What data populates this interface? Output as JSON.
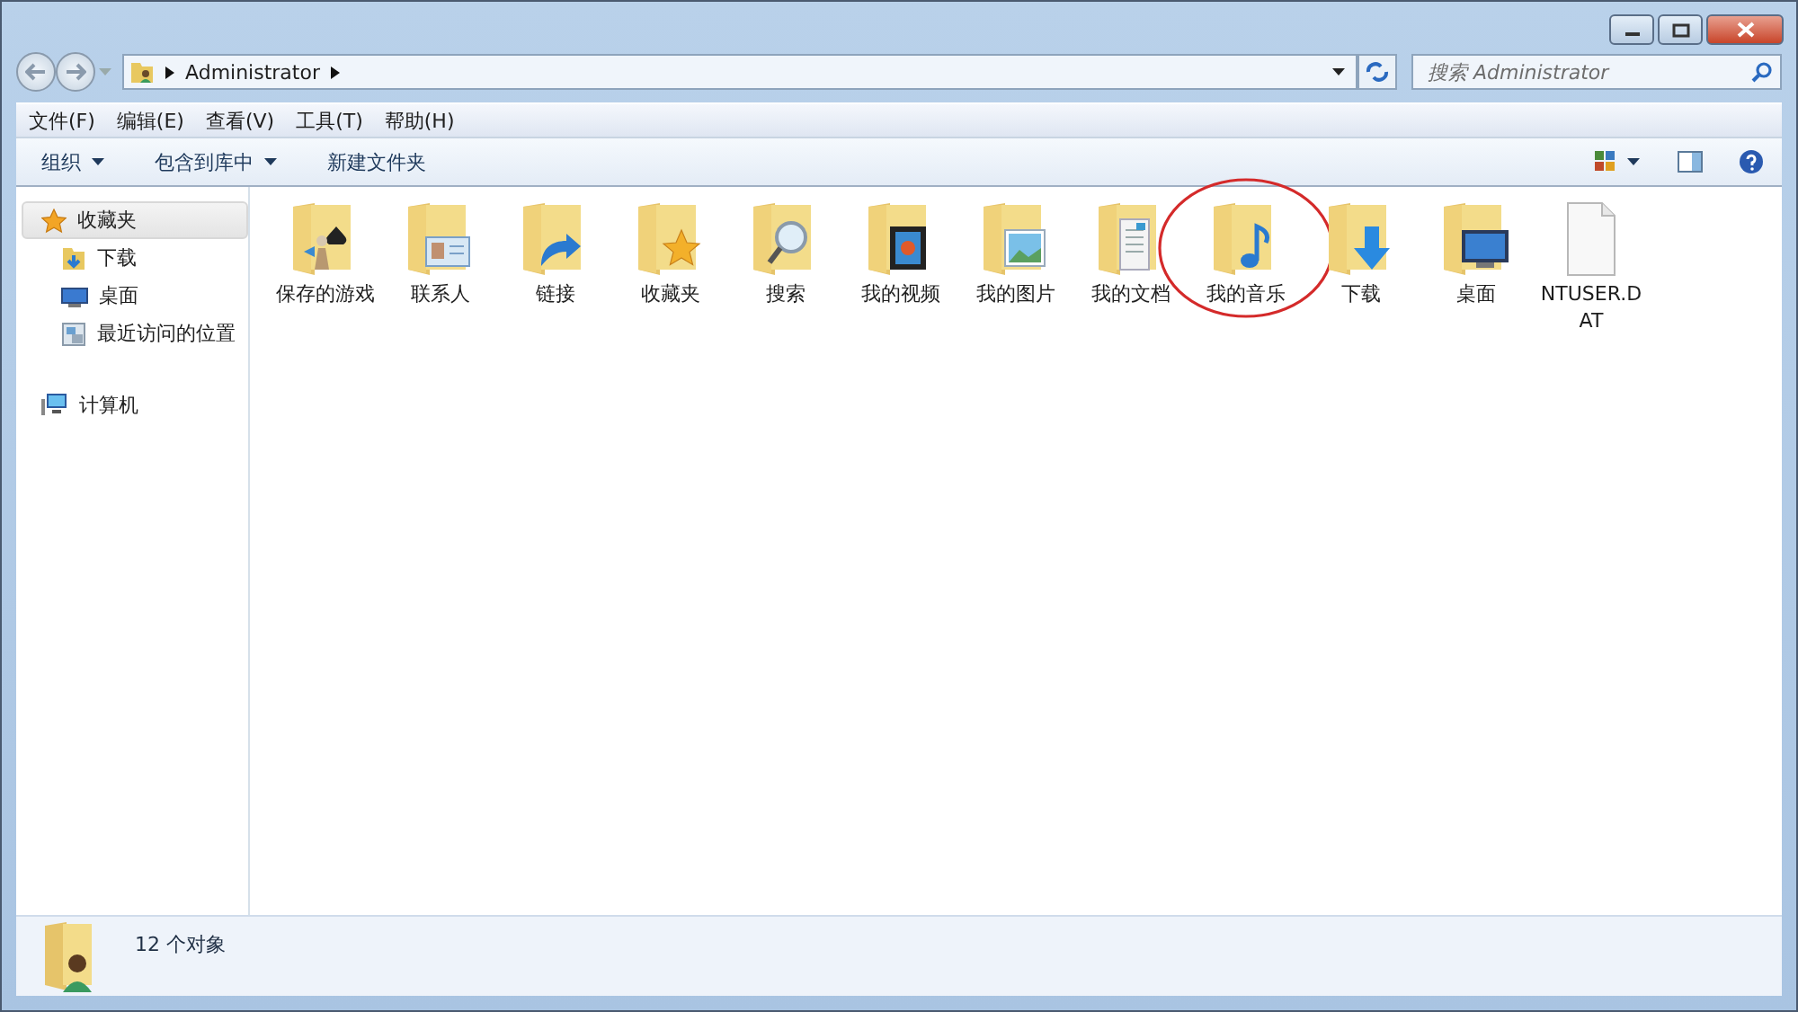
{
  "address": {
    "crumbs": [
      "Administrator"
    ]
  },
  "search": {
    "placeholder": "搜索 Administrator"
  },
  "menu": [
    "文件(F)",
    "编辑(E)",
    "查看(V)",
    "工具(T)",
    "帮助(H)"
  ],
  "toolbar": [
    {
      "label": "组织",
      "dropdown": true
    },
    {
      "label": "包含到库中",
      "dropdown": true
    },
    {
      "label": "新建文件夹",
      "dropdown": false
    }
  ],
  "sidebar": {
    "items": [
      {
        "label": "收藏夹",
        "kind": "star",
        "selected": true,
        "children": [
          {
            "label": "下载",
            "kind": "download",
            "selected": false
          },
          {
            "label": "桌面",
            "kind": "desktop",
            "selected": false
          },
          {
            "label": "最近访问的位置",
            "kind": "recent",
            "selected": false
          }
        ]
      },
      {
        "label": "计算机",
        "kind": "computer",
        "selected": false
      }
    ]
  },
  "files": [
    {
      "name": "保存的游戏",
      "kind": "game",
      "highlighted": false
    },
    {
      "name": "联系人",
      "kind": "contact",
      "highlighted": false
    },
    {
      "name": "链接",
      "kind": "link",
      "highlighted": false
    },
    {
      "name": "收藏夹",
      "kind": "star",
      "highlighted": false
    },
    {
      "name": "搜索",
      "kind": "search",
      "highlighted": false
    },
    {
      "name": "我的视频",
      "kind": "video",
      "highlighted": false
    },
    {
      "name": "我的图片",
      "kind": "picture",
      "highlighted": false
    },
    {
      "name": "我的文档",
      "kind": "document",
      "highlighted": false
    },
    {
      "name": "我的音乐",
      "kind": "music",
      "highlighted": true
    },
    {
      "name": "下载",
      "kind": "download",
      "highlighted": false
    },
    {
      "name": "桌面",
      "kind": "desktop",
      "highlighted": false
    },
    {
      "name": "NTUSER.DAT",
      "kind": "file",
      "highlighted": false
    }
  ],
  "status_bar": {
    "count": "12 个对象"
  }
}
